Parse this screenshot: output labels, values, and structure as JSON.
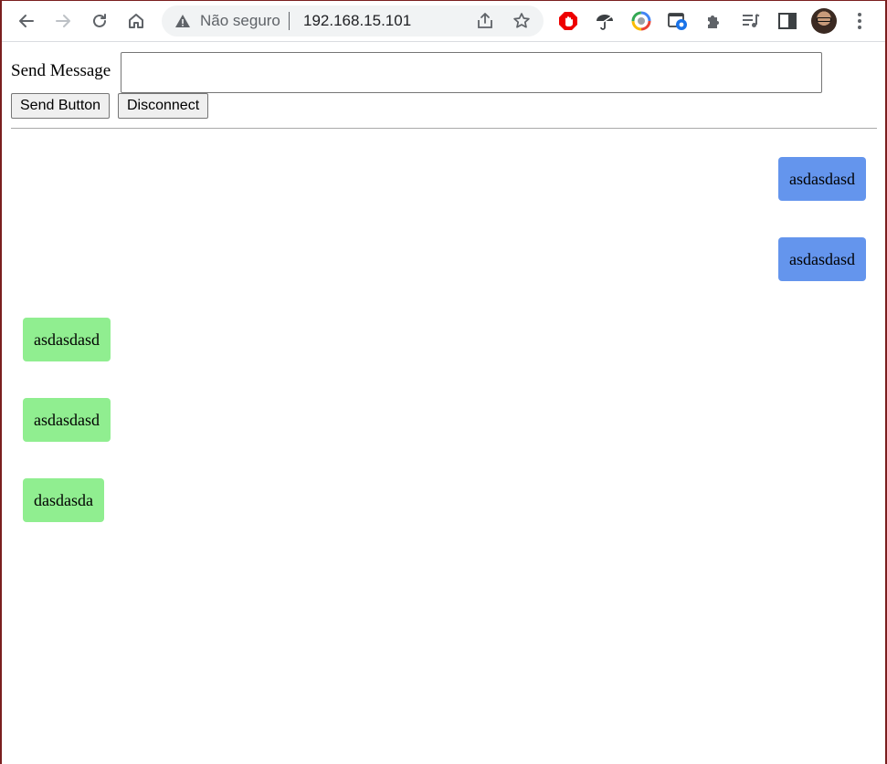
{
  "browser": {
    "security_label": "Não seguro",
    "url": "192.168.15.101",
    "icons": [
      "back-icon",
      "forward-icon",
      "reload-icon",
      "home-icon",
      "warning-icon",
      "share-icon",
      "star-icon",
      "adblock-icon",
      "umbrella-extension-icon",
      "color-extension-icon",
      "screenshot-extension-icon",
      "extensions-puzzle-icon",
      "media-queue-icon",
      "side-panel-icon",
      "profile-avatar",
      "menu-kebab-icon"
    ]
  },
  "form": {
    "label": "Send Message",
    "input_value": "",
    "send_button": "Send Button",
    "disconnect_button": "Disconnect"
  },
  "messages": [
    {
      "side": "sent",
      "text": "asdasdasd"
    },
    {
      "side": "sent",
      "text": "asdasdasd"
    },
    {
      "side": "received",
      "text": "asdasdasd"
    },
    {
      "side": "received",
      "text": "asdasdasd"
    },
    {
      "side": "received",
      "text": "dasdasda"
    }
  ],
  "colors": {
    "sent": "#6495ed",
    "received": "#90ee90",
    "frame": "#7a1f1f"
  }
}
